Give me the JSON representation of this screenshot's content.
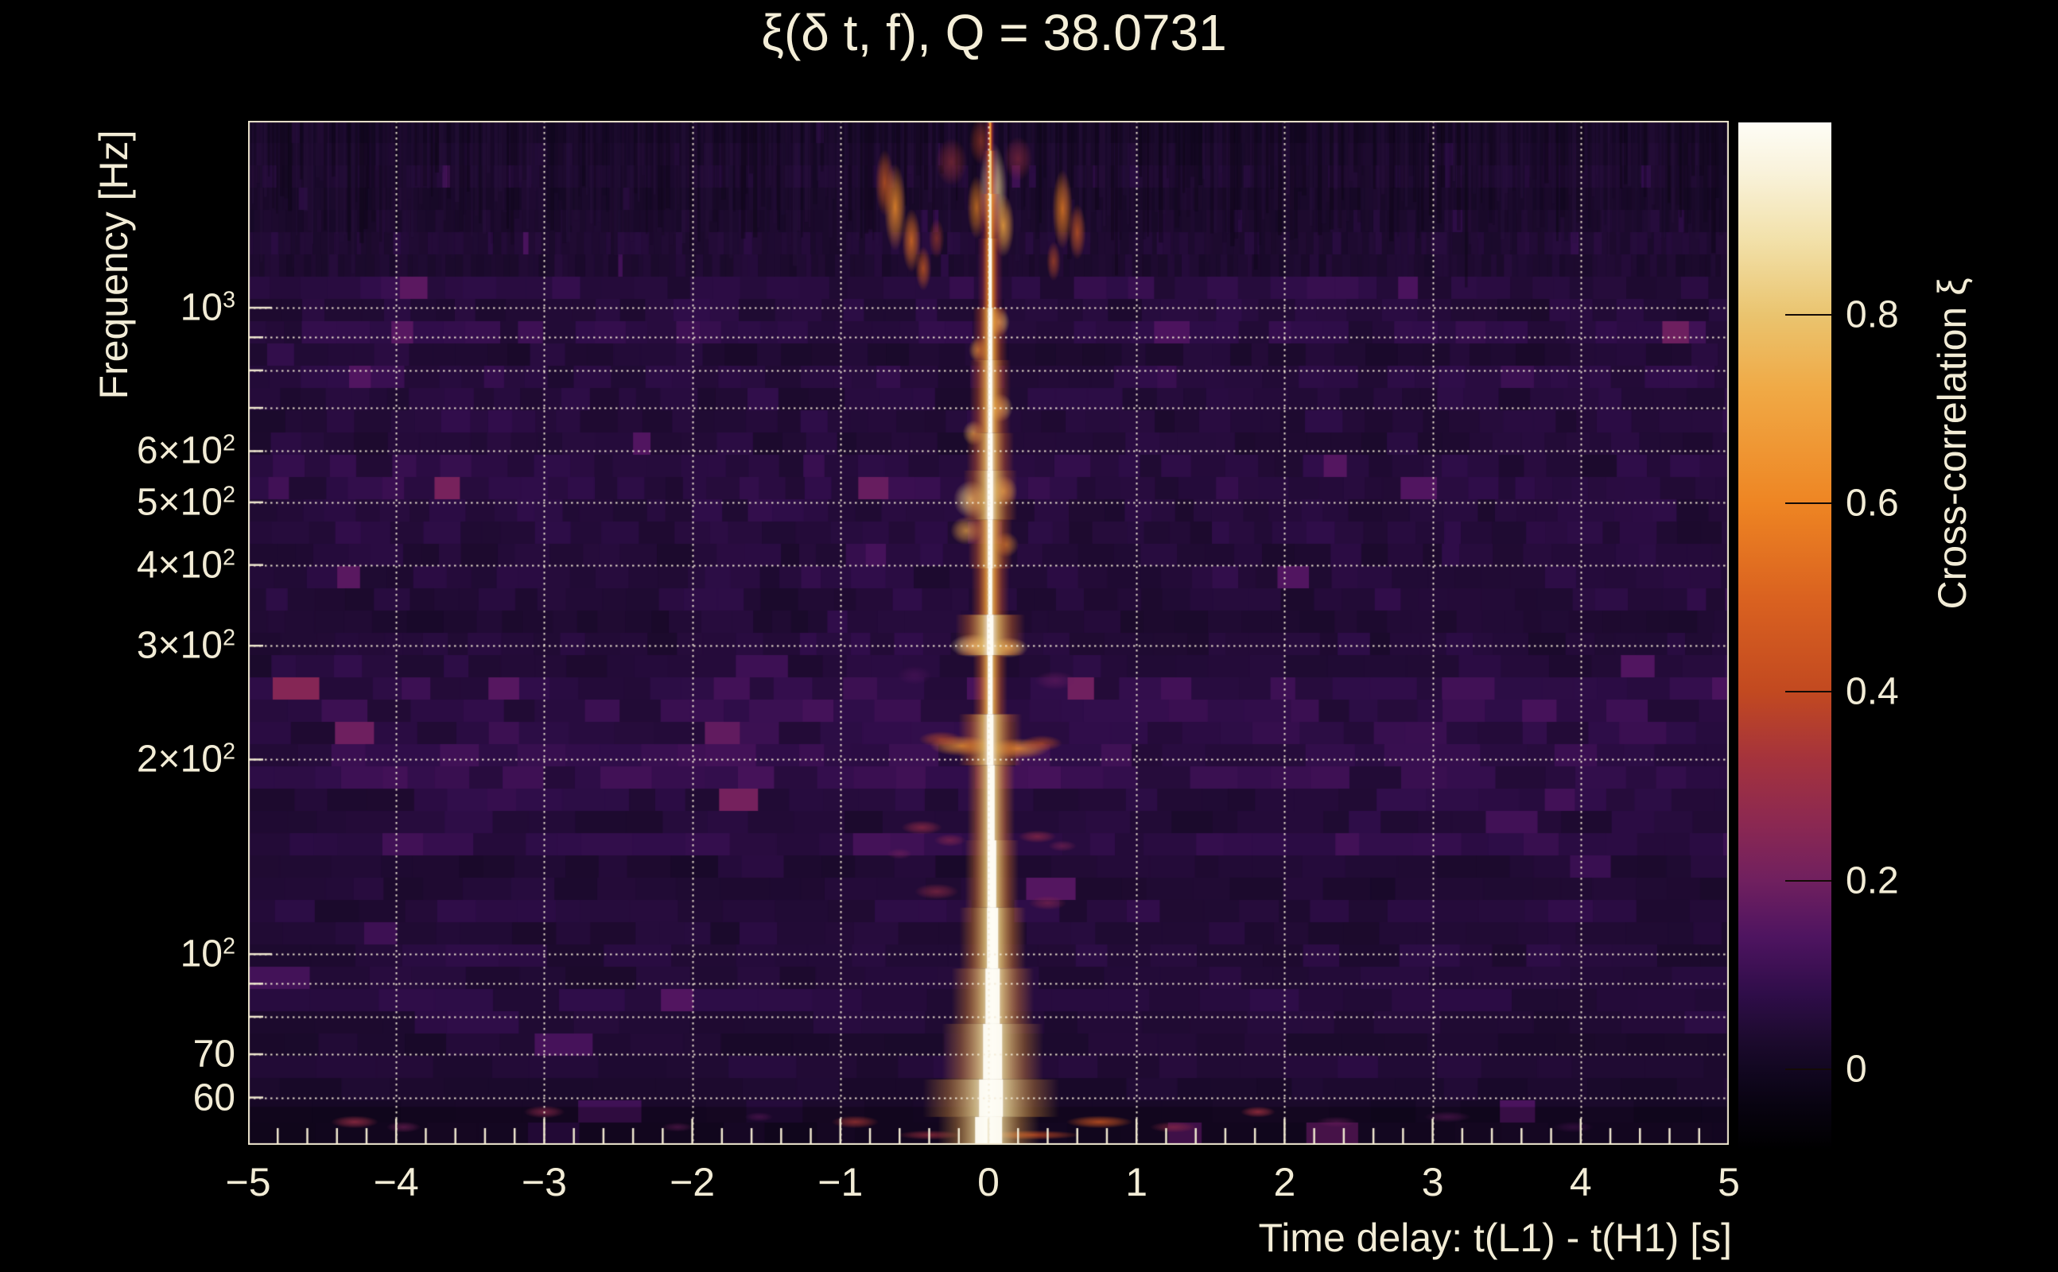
{
  "title": {
    "text": "ξ(δ t, f), Q = 38.0731"
  },
  "chart_data": {
    "type": "heatmap",
    "title": "ξ(δ t, f), Q = 38.0731",
    "q_value": 38.0731,
    "xlabel": "Time delay: t(L1) - t(H1) [s]",
    "ylabel": "Frequency [Hz]",
    "x_range": [
      -5,
      5
    ],
    "y_scale": "log",
    "y_range_hz": [
      50.7,
      1946
    ],
    "x_ticks": {
      "major": [
        -5,
        -4,
        -3,
        -2,
        -1,
        0,
        1,
        2,
        3,
        4,
        5
      ],
      "labels": [
        "−5",
        "−4",
        "−3",
        "−2",
        "−1",
        "0",
        "1",
        "2",
        "3",
        "4",
        "5"
      ],
      "minor_step": 0.2
    },
    "y_ticks": {
      "labeled": [
        {
          "f": 1000,
          "pre": "10",
          "sup": "3"
        },
        {
          "f": 600,
          "pre": "6×10",
          "sup": "2"
        },
        {
          "f": 500,
          "pre": "5×10",
          "sup": "2"
        },
        {
          "f": 400,
          "pre": "4×10",
          "sup": "2"
        },
        {
          "f": 300,
          "pre": "3×10",
          "sup": "2"
        },
        {
          "f": 200,
          "pre": "2×10",
          "sup": "2"
        },
        {
          "f": 100,
          "pre": "10",
          "sup": "2"
        },
        {
          "f": 70,
          "pre": "70",
          "sup": ""
        },
        {
          "f": 60,
          "pre": "60",
          "sup": ""
        }
      ],
      "minor": [
        60,
        70,
        80,
        90,
        100,
        200,
        300,
        400,
        500,
        600,
        700,
        800,
        900,
        1000
      ]
    },
    "grid": {
      "x": [
        -4,
        -3,
        -2,
        -1,
        0,
        1,
        2,
        3,
        4
      ],
      "y": [
        60,
        70,
        80,
        90,
        100,
        200,
        300,
        400,
        500,
        600,
        700,
        800,
        900,
        1000
      ],
      "style": "dotted",
      "color": "#f4ecd7"
    },
    "frame_color": "#f0e8d0",
    "label_color": "#f2ecd6",
    "colorbar": {
      "label": "Cross-correlation ξ",
      "value_range": [
        -0.086,
        1.004
      ],
      "ticks": [
        {
          "v": 0.8,
          "label": "0.8"
        },
        {
          "v": 0.6,
          "label": "0.6"
        },
        {
          "v": 0.4,
          "label": "0.4"
        },
        {
          "v": 0.2,
          "label": "0.2"
        },
        {
          "v": 0,
          "label": "0"
        }
      ],
      "stops": [
        [
          1.004,
          "#fefdf6"
        ],
        [
          0.95,
          "#f9f2da"
        ],
        [
          0.88,
          "#f2e1aa"
        ],
        [
          0.8,
          "#eac46f"
        ],
        [
          0.72,
          "#f0a945"
        ],
        [
          0.6,
          "#ee8523"
        ],
        [
          0.5,
          "#da6220"
        ],
        [
          0.4,
          "#c24920"
        ],
        [
          0.33,
          "#a5333c"
        ],
        [
          0.26,
          "#8b2852"
        ],
        [
          0.2,
          "#70205f"
        ],
        [
          0.14,
          "#4e1460"
        ],
        [
          0.08,
          "#2f0d49"
        ],
        [
          0.03,
          "#1c0a2d"
        ],
        [
          0.0,
          "#120721"
        ],
        [
          -0.04,
          "#080310"
        ],
        [
          -0.086,
          "#000000"
        ]
      ]
    },
    "background": {
      "base_value": 0.05,
      "bands": [
        [
          1800,
          0.28
        ],
        [
          1300,
          0.55
        ],
        [
          1100,
          0.7
        ],
        [
          700,
          0.95
        ],
        [
          560,
          1.05
        ],
        [
          420,
          0.95
        ],
        [
          300,
          0.8
        ],
        [
          230,
          1.1
        ],
        [
          185,
          1.25
        ],
        [
          140,
          1.05
        ],
        [
          100,
          0.9
        ],
        [
          75,
          0.8
        ],
        [
          63,
          0.7
        ],
        [
          58,
          0.45
        ],
        [
          0,
          0.3
        ]
      ],
      "cell_widths": [
        [
          1100,
          9
        ],
        [
          300,
          34
        ],
        [
          100,
          48
        ],
        [
          0,
          66
        ]
      ],
      "streak_min_freq": 1250,
      "rows": 46,
      "seed": 1234
    },
    "ridge": {
      "t": 0.012,
      "segments_format": "[f_hi, f_lo, halo_px, core_px, v_core, v_halo, dx_px]",
      "segments": [
        [
          1946,
          1750,
          8,
          2,
          0.55,
          0.18,
          0
        ],
        [
          1750,
          1500,
          10,
          3,
          0.7,
          0.22,
          0
        ],
        [
          1500,
          1280,
          14,
          3,
          0.8,
          0.3,
          0
        ],
        [
          1280,
          1000,
          16,
          4,
          0.85,
          0.32,
          0
        ],
        [
          1000,
          830,
          22,
          5,
          0.95,
          0.4,
          0
        ],
        [
          830,
          640,
          26,
          5,
          0.98,
          0.45,
          0
        ],
        [
          640,
          560,
          30,
          6,
          1.0,
          0.5,
          0
        ],
        [
          560,
          470,
          34,
          7,
          1.0,
          0.55,
          0
        ],
        [
          470,
          395,
          28,
          6,
          0.95,
          0.5,
          0
        ],
        [
          395,
          335,
          24,
          5,
          0.9,
          0.45,
          0
        ],
        [
          335,
          290,
          44,
          8,
          1.0,
          0.55,
          0
        ],
        [
          290,
          235,
          22,
          6,
          0.95,
          0.5,
          0
        ],
        [
          235,
          196,
          40,
          8,
          1.0,
          0.55,
          0
        ],
        [
          196,
          150,
          30,
          9,
          1.0,
          0.6,
          1
        ],
        [
          150,
          118,
          34,
          11,
          1.0,
          0.6,
          2
        ],
        [
          118,
          95,
          42,
          14,
          1.0,
          0.62,
          3
        ],
        [
          95,
          78,
          52,
          18,
          1.0,
          0.65,
          3
        ],
        [
          78,
          64,
          64,
          24,
          1.0,
          0.68,
          3
        ],
        [
          64,
          56,
          86,
          30,
          1.0,
          0.7,
          1
        ],
        [
          56,
          50.8,
          64,
          34,
          1.0,
          0.72,
          -2
        ]
      ]
    },
    "features_format": "[t_sec, freq_hz, rx_px, ry_px, xi_value, alpha]",
    "features": [
      [
        -0.63,
        1430,
        14,
        55,
        0.62,
        0.85
      ],
      [
        -0.7,
        1560,
        12,
        42,
        0.5,
        0.7
      ],
      [
        -0.52,
        1270,
        12,
        40,
        0.55,
        0.8
      ],
      [
        -0.44,
        1150,
        10,
        28,
        0.5,
        0.7
      ],
      [
        -0.35,
        1280,
        10,
        25,
        0.4,
        0.5
      ],
      [
        0.5,
        1420,
        13,
        50,
        0.58,
        0.8
      ],
      [
        0.6,
        1310,
        11,
        35,
        0.5,
        0.7
      ],
      [
        0.44,
        1180,
        9,
        25,
        0.45,
        0.6
      ],
      [
        0.03,
        1520,
        18,
        60,
        0.85,
        0.9
      ],
      [
        0.1,
        1340,
        14,
        40,
        0.7,
        0.85
      ],
      [
        -0.08,
        1430,
        12,
        40,
        0.6,
        0.7
      ],
      [
        -0.25,
        1680,
        20,
        30,
        0.35,
        0.5
      ],
      [
        0.2,
        1700,
        18,
        28,
        0.33,
        0.5
      ],
      [
        -0.05,
        1810,
        15,
        30,
        0.4,
        0.5
      ],
      [
        0.07,
        950,
        14,
        18,
        0.8,
        0.8
      ],
      [
        -0.07,
        860,
        12,
        16,
        0.7,
        0.7
      ],
      [
        0.08,
        700,
        16,
        18,
        0.8,
        0.75
      ],
      [
        -0.1,
        640,
        14,
        16,
        0.75,
        0.7
      ],
      [
        -0.12,
        505,
        22,
        24,
        0.82,
        0.8
      ],
      [
        0.1,
        520,
        18,
        20,
        0.75,
        0.7
      ],
      [
        -0.15,
        452,
        20,
        18,
        0.72,
        0.7
      ],
      [
        0.12,
        430,
        16,
        16,
        0.65,
        0.6
      ],
      [
        -0.1,
        300,
        30,
        15,
        0.85,
        0.85
      ],
      [
        0.13,
        298,
        26,
        13,
        0.8,
        0.8
      ],
      [
        -0.18,
        210,
        40,
        13,
        0.65,
        0.8
      ],
      [
        0.2,
        208,
        40,
        13,
        0.65,
        0.8
      ],
      [
        -0.32,
        215,
        28,
        10,
        0.45,
        0.6
      ],
      [
        0.36,
        212,
        26,
        10,
        0.45,
        0.6
      ],
      [
        0.45,
        265,
        26,
        12,
        0.18,
        0.6
      ],
      [
        -0.5,
        270,
        22,
        12,
        0.15,
        0.5
      ],
      [
        -0.45,
        157,
        26,
        9,
        0.3,
        0.7
      ],
      [
        -0.26,
        150,
        20,
        8,
        0.28,
        0.6
      ],
      [
        0.33,
        152,
        24,
        8,
        0.3,
        0.65
      ],
      [
        0.5,
        147,
        18,
        7,
        0.25,
        0.55
      ],
      [
        -0.6,
        143,
        16,
        7,
        0.22,
        0.5
      ],
      [
        -0.35,
        125,
        28,
        10,
        0.3,
        0.6
      ],
      [
        0.4,
        120,
        24,
        9,
        0.28,
        0.55
      ],
      [
        -4.28,
        55,
        30,
        8,
        0.3,
        0.8
      ],
      [
        -3.95,
        54,
        22,
        7,
        0.22,
        0.6
      ],
      [
        -3.0,
        57,
        26,
        8,
        0.28,
        0.7
      ],
      [
        -2.1,
        54,
        20,
        6,
        0.2,
        0.5
      ],
      [
        -1.55,
        56,
        18,
        6,
        0.18,
        0.5
      ],
      [
        -0.9,
        55,
        30,
        8,
        0.35,
        0.7
      ],
      [
        0.75,
        55,
        42,
        8,
        0.45,
        0.8
      ],
      [
        1.25,
        54,
        30,
        7,
        0.3,
        0.6
      ],
      [
        1.82,
        57,
        22,
        7,
        0.32,
        0.8
      ],
      [
        2.35,
        55,
        26,
        7,
        0.2,
        0.5
      ],
      [
        3.1,
        56,
        30,
        7,
        0.18,
        0.5
      ],
      [
        3.95,
        54,
        26,
        7,
        0.16,
        0.4
      ],
      [
        0.3,
        52.5,
        60,
        6,
        0.4,
        0.8
      ],
      [
        -0.4,
        52.5,
        40,
        6,
        0.32,
        0.7
      ]
    ]
  }
}
